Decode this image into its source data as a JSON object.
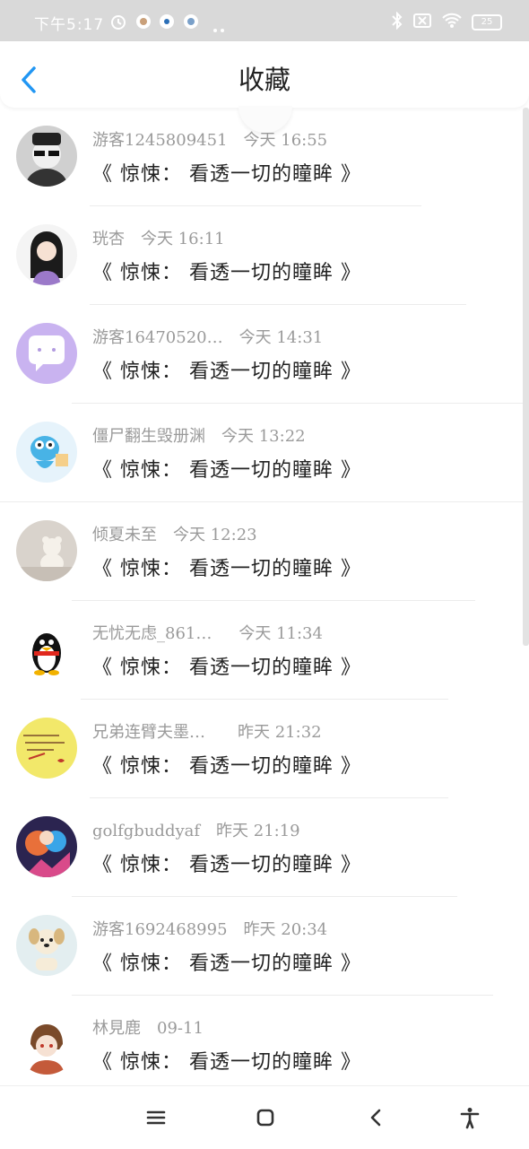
{
  "status_bar": {
    "time": "下午5:17",
    "battery": "25"
  },
  "header": {
    "title": "收藏"
  },
  "items": [
    {
      "user": "游客1245809451",
      "time": "今天 16:55",
      "content": "《 惊悚： 看透一切的瞳眸 》",
      "avatar": "dark-hat-portrait"
    },
    {
      "user": "珖杏",
      "time": "今天 16:11",
      "content": "《 惊悚： 看透一切的瞳眸 》",
      "avatar": "anime-girl"
    },
    {
      "user": "游客16470520…",
      "time": "今天 14:31",
      "content": "《 惊悚： 看透一切的瞳眸 》",
      "avatar": "chat-bubble"
    },
    {
      "user": "僵尸翻生毁册渊",
      "time": "今天 13:22",
      "content": "《 惊悚： 看透一切的瞳眸 》",
      "avatar": "blue-cartoon"
    },
    {
      "user": "倾夏未至",
      "time": "今天 12:23",
      "content": "《 惊悚： 看透一切的瞳眸 》",
      "avatar": "teddy-bear"
    },
    {
      "user": "无忧无虑_861…",
      "time": "今天 11:34",
      "content": "《 惊悚： 看透一切的瞳眸 》",
      "avatar": "penguin"
    },
    {
      "user": "兄弟连臂夫墨…",
      "time": "昨天 21:32",
      "content": "《 惊悚： 看透一切的瞳眸 》",
      "avatar": "yellow-note"
    },
    {
      "user": "golfgbuddyaf",
      "time": "昨天 21:19",
      "content": "《 惊悚： 看透一切的瞳眸 》",
      "avatar": "colorful-hero"
    },
    {
      "user": "游客1692468995",
      "time": "昨天 20:34",
      "content": "《 惊悚： 看透一切的瞳眸 》",
      "avatar": "puppy"
    },
    {
      "user": "林見鹿",
      "time": "09-11",
      "content": "《 惊悚： 看透一切的瞳眸 》",
      "avatar": "brown-hair-chibi"
    }
  ],
  "colors": {
    "accent": "#2196f3",
    "statusbar": "#d9d9d9"
  }
}
